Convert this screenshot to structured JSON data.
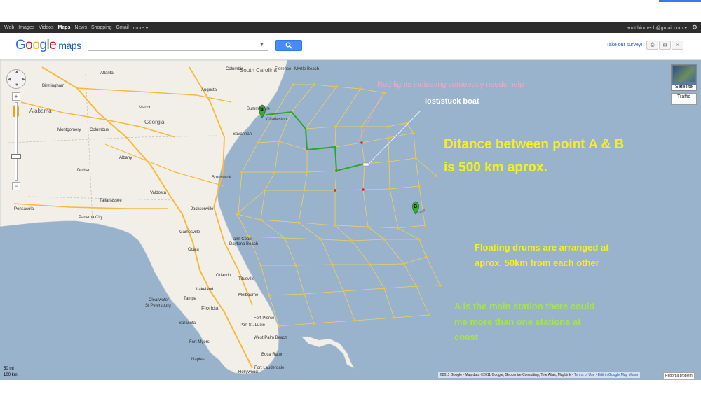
{
  "top_bar_links": [
    "Web",
    "Images",
    "Videos",
    "Maps",
    "News",
    "Shopping",
    "Gmail",
    "more ▾"
  ],
  "account": "amit.biomech@gmail.com ▾",
  "logo": {
    "google": "Google",
    "maps": "maps"
  },
  "search": {
    "value": "",
    "button_icon": "search-icon"
  },
  "survey_link": "Take our survey!",
  "header_icons": [
    "print-icon",
    "mail-icon",
    "link-icon"
  ],
  "map_controls": {
    "satellite": "Satellite",
    "traffic": "Traffic",
    "zoom_in": "+",
    "zoom_out": "−"
  },
  "scale": {
    "miles": "50 mi",
    "km": "100 km"
  },
  "map_labels": {
    "states": [
      "South Carolina",
      "Georgia",
      "Alabama",
      "Florida"
    ],
    "cities": [
      "Atlanta",
      "Birmingham",
      "Montgomery",
      "Columbus",
      "Macon",
      "Augusta",
      "Columbia",
      "Charleston",
      "Savannah",
      "Tallahassee",
      "Jacksonville",
      "Gainesville",
      "Orlando",
      "Tampa",
      "Clearwater",
      "St Petersburg",
      "Sarasota",
      "Fort Myers",
      "Naples",
      "West Palm Beach",
      "Boca Raton",
      "Fort Lauderdale",
      "Hollywood",
      "Daytona Beach",
      "Palm Coast",
      "Titusville",
      "Melbourne",
      "Port St. Lucie",
      "Fort Pierce",
      "Dothan",
      "Albany",
      "Valdosta",
      "Brunswick",
      "Ocala",
      "Lakeland",
      "Pensacola",
      "Panama City",
      "Myrtle Beach",
      "Florence",
      "Summerville"
    ]
  },
  "markers": {
    "a": "A",
    "b": "B"
  },
  "annotations": {
    "red_lights": "Red lights indicating somebody needs help",
    "lost_boat": "lost/stuck boat",
    "distance_line1": "Ditance between point A & B",
    "distance_line2": "is 500 km aprox.",
    "drums_line1": "Floating drums are arranged at",
    "drums_line2": "aprox. 50km from each other",
    "station_line1": "A is the main station there could",
    "station_line2": "me more than one stations at",
    "station_line3": "coast"
  },
  "attribution": {
    "text": "©2011 Google - Map data ©2011 Google, Geocentre Consulting, Tele Atlas, MapLink -",
    "terms": "Terms of Use",
    "edit": "Edit in Google Map Maker"
  },
  "report_problem": "Report a problem",
  "colors": {
    "ocean": "#99b3cc",
    "land": "#f2efe9",
    "grid_line": "#f0d060",
    "grid_node": "#f5c023",
    "help_node": "#e02020",
    "route": "#2ea52e",
    "highway": "#f6b93b"
  }
}
